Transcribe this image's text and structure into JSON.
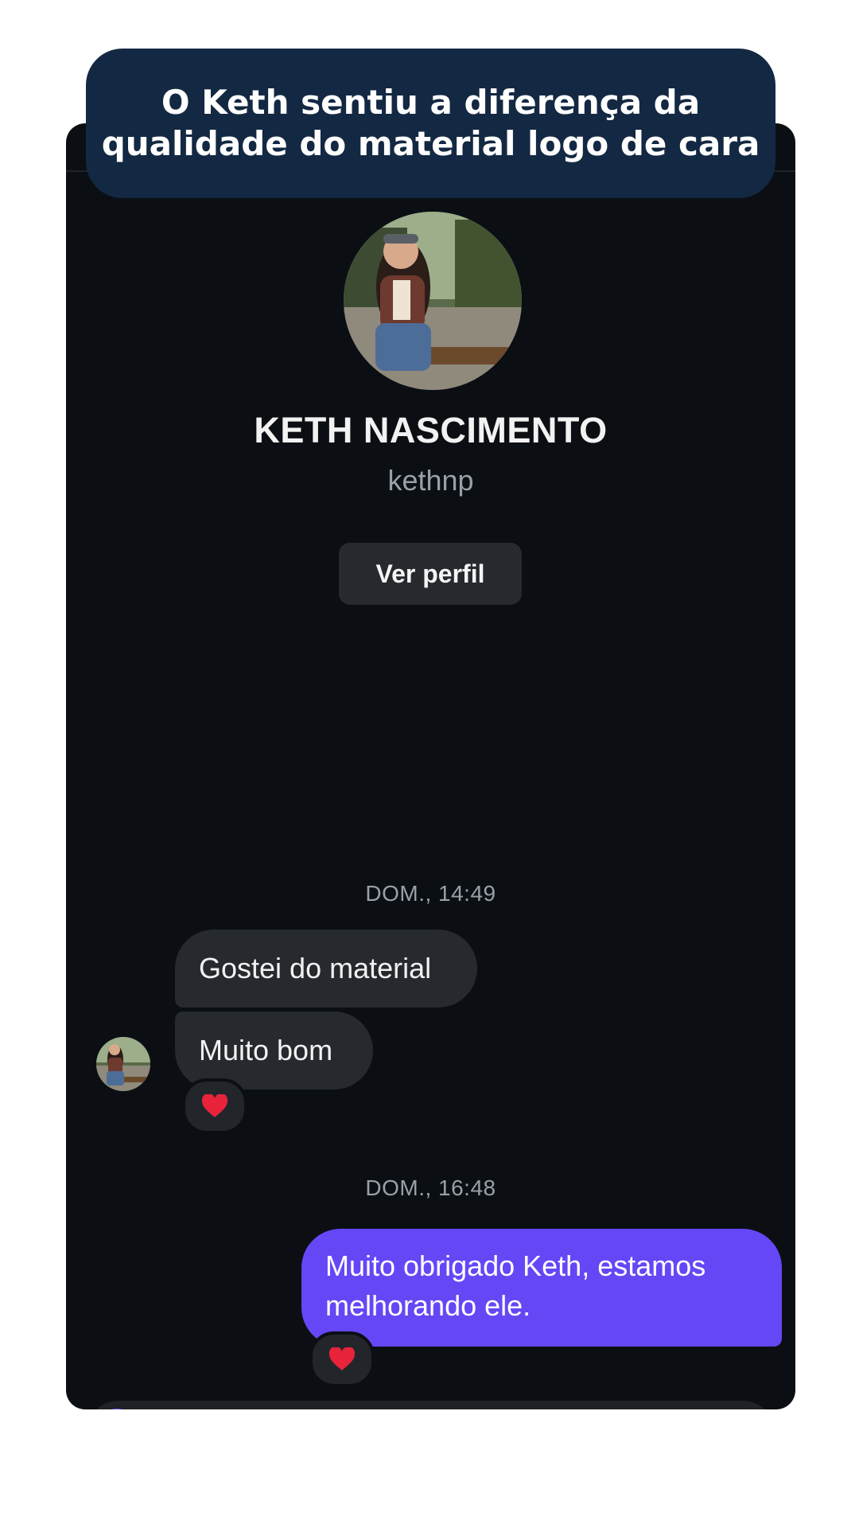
{
  "headline": {
    "line1": "O Keth sentiu a diferença da",
    "line2": "qualidade do material logo de cara"
  },
  "profile": {
    "name": "KETH NASCIMENTO",
    "handle": "kethnp",
    "view_profile_label": "Ver perfil"
  },
  "conversation": {
    "groups": [
      {
        "timestamp": "DOM., 14:49",
        "messages": [
          {
            "direction": "incoming",
            "text": "Gostei do material"
          },
          {
            "direction": "incoming",
            "text": "Muito bom",
            "reaction": "heart"
          }
        ]
      },
      {
        "timestamp": "DOM., 16:48",
        "messages": [
          {
            "direction": "outgoing",
            "text": "Muito obrigado Keth, estamos melhorando ele.",
            "reaction": "heart"
          }
        ]
      }
    ]
  },
  "colors": {
    "headline_bg": "#132842",
    "chat_bg": "#0b0f14",
    "incoming_bubble": "#26292e",
    "outgoing_bubble": "#6547f6",
    "reaction_heart": "#e8233b"
  }
}
